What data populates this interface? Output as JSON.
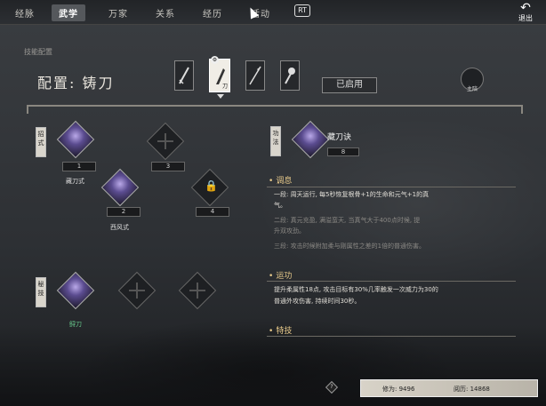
{
  "nav": {
    "tabs": [
      "经脉",
      "武学",
      "万家",
      "关系",
      "经历",
      "活动"
    ],
    "active_tab": "武学",
    "rt_label": "RT",
    "back_label": "退出"
  },
  "config": {
    "section_label": "技能配置",
    "title": "配置: 铸刀",
    "weapon_tag": "刀",
    "enabled_button": "已启用",
    "zhuxue_label": "主陪"
  },
  "left": {
    "zhaoshi_label": "招式",
    "mishi_label": "秘技",
    "slots": [
      {
        "num": "1",
        "name": "藏刀式"
      },
      {
        "num": "2",
        "name": "西风式"
      },
      {
        "num": "3",
        "name": ""
      },
      {
        "num": "4",
        "name": ""
      }
    ],
    "secret_skill_name": "鲟刀"
  },
  "right": {
    "gongfa_label": "功法",
    "skill_name": "藏刀诀",
    "skill_count": "8",
    "tiaoxi": {
      "heading": "调息",
      "lines": [
        "一段: 周天运行, 每5秒恢复根骨+1的生命和元气+1的真",
        "气。",
        "二段: 真元充盈, 满溢蛮天, 当真气大于400点时候, 提",
        "升双攻劲。",
        "三段: 攻击时候附加柔与刚属性之差的1倍的普通伤害。"
      ]
    },
    "yungong": {
      "heading": "运功",
      "lines": [
        "提升柔属性18点, 攻击目标有30%几率触发一次威力为30的",
        "普通外攻伤害, 持续时间30秒。"
      ]
    },
    "teji": {
      "heading": "特技"
    }
  },
  "bottom": {
    "xiuwei_label": "修为: 9496",
    "yueli_label": "阅历: 14868",
    "help": "?"
  }
}
